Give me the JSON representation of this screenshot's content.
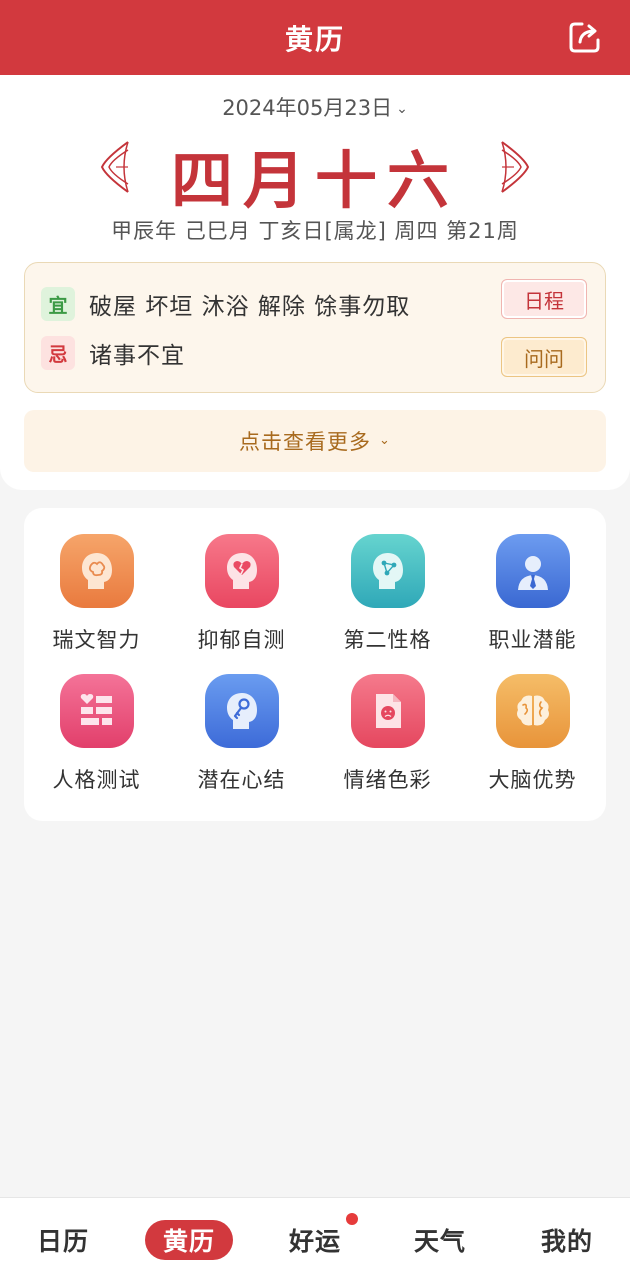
{
  "header": {
    "title": "黄历",
    "share_icon": "share-icon"
  },
  "date": {
    "selected": "2024年05月23日",
    "lunar_day": "四月十六",
    "ganzhi": "甲辰年 己巳月 丁亥日[属龙] 周四 第21周"
  },
  "yiji": {
    "yi_tag": "宜",
    "yi_text": "破屋 坏垣 沐浴 解除 馀事勿取",
    "ji_tag": "忌",
    "ji_text": "诸事不宜",
    "schedule_label": "日程",
    "ask_label": "问问"
  },
  "more": {
    "label": "点击查看更多"
  },
  "tests": [
    {
      "label": "瑞文智力",
      "icon": "brain-head-icon",
      "color": "#ee8a4c"
    },
    {
      "label": "抑郁自测",
      "icon": "broken-heart-head-icon",
      "color": "#ef5b6f"
    },
    {
      "label": "第二性格",
      "icon": "network-head-icon",
      "color": "#3fbfbd"
    },
    {
      "label": "职业潜能",
      "icon": "businessman-icon",
      "color": "#4a7ee0"
    },
    {
      "label": "人格测试",
      "icon": "heart-wall-icon",
      "color": "#ec4d78"
    },
    {
      "label": "潜在心结",
      "icon": "key-head-icon",
      "color": "#4d7ee0"
    },
    {
      "label": "情绪色彩",
      "icon": "sad-document-icon",
      "color": "#ee5a6f"
    },
    {
      "label": "大脑优势",
      "icon": "brain-icon",
      "color": "#efa64a"
    }
  ],
  "nav": {
    "items": [
      {
        "label": "日历"
      },
      {
        "label": "黄历"
      },
      {
        "label": "好运"
      },
      {
        "label": "天气"
      },
      {
        "label": "我的"
      }
    ],
    "active_index": 1,
    "badge_index": 2
  },
  "colors": {
    "brand": "#d2393e",
    "accent_gold": "#a86a1e"
  }
}
